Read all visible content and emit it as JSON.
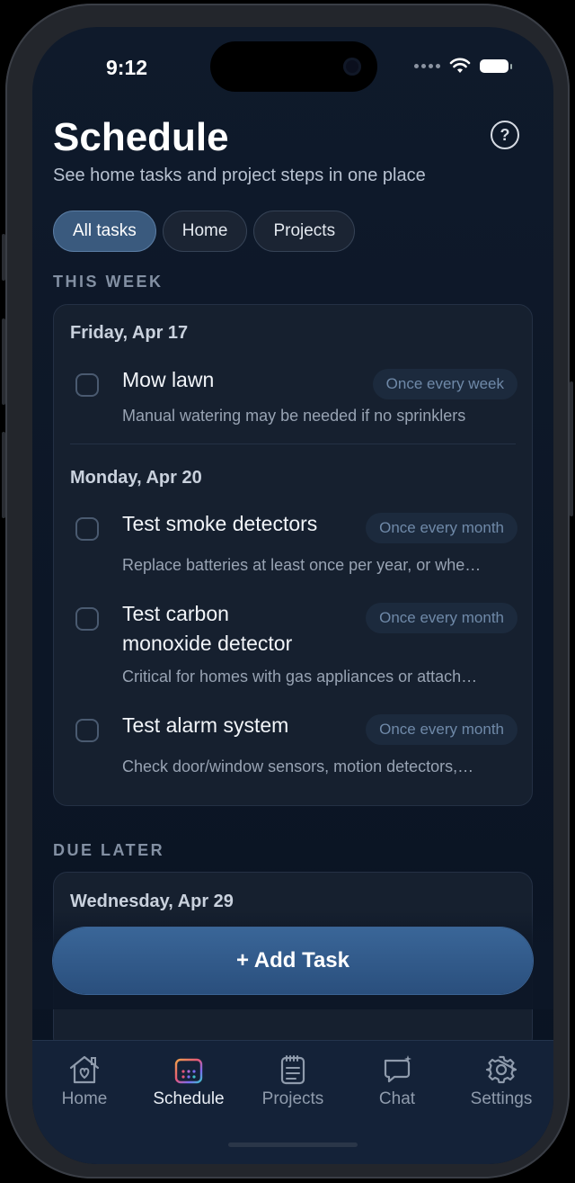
{
  "status": {
    "time": "9:12"
  },
  "header": {
    "title": "Schedule",
    "subtitle": "See home tasks and project steps in one place",
    "help_glyph": "?"
  },
  "filters": [
    {
      "label": "All tasks",
      "active": true
    },
    {
      "label": "Home",
      "active": false
    },
    {
      "label": "Projects",
      "active": false
    }
  ],
  "this_week": {
    "heading": "THIS WEEK",
    "groups": [
      {
        "date": "Friday, Apr 17",
        "tasks": [
          {
            "title": "Mow lawn",
            "frequency": "Once every week",
            "description": "Manual watering may be needed if no sprinklers"
          }
        ]
      },
      {
        "date": "Monday, Apr 20",
        "tasks": [
          {
            "title": "Test smoke detectors",
            "frequency": "Once every month",
            "description": "Replace batteries at least once per year, or whe…"
          },
          {
            "title_line1": "Test carbon",
            "title_line2": "monoxide detector",
            "frequency": "Once every month",
            "description": "Critical for homes with gas appliances or attach…"
          },
          {
            "title": "Test alarm system",
            "frequency": "Once every month",
            "description": "Check door/window sensors, motion detectors,…"
          }
        ]
      }
    ]
  },
  "due_later": {
    "heading": "DUE LATER",
    "groups": [
      {
        "date": "Wednesday, Apr 29"
      }
    ]
  },
  "add_task_label": "+ Add Task",
  "tabs": [
    {
      "label": "Home",
      "icon": "house-heart-icon",
      "active": false
    },
    {
      "label": "Schedule",
      "icon": "calendar-icon",
      "active": true
    },
    {
      "label": "Projects",
      "icon": "clipboard-list-icon",
      "active": false
    },
    {
      "label": "Chat",
      "icon": "chat-sparkle-icon",
      "active": false
    },
    {
      "label": "Settings",
      "icon": "gear-icon",
      "active": false
    }
  ],
  "colors": {
    "accent": "#3a6698",
    "background": "#0f1a2b",
    "card": "#16202f",
    "chip_active": "#3a5a7e"
  }
}
